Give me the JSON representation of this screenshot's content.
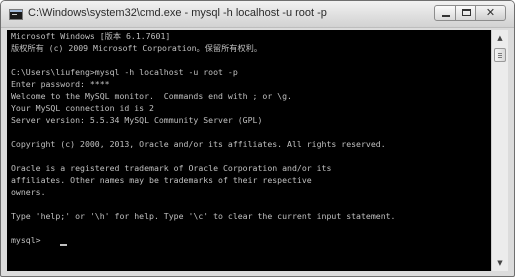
{
  "window": {
    "title": "C:\\Windows\\system32\\cmd.exe - mysql  -h localhost -u root -p",
    "icon": "terminal-icon",
    "controls": {
      "minimize_icon": "minimize-icon",
      "maximize_icon": "maximize-icon",
      "close_icon": "close-icon",
      "close_glyph": "✕"
    }
  },
  "console": {
    "background": "#000000",
    "foreground": "#c0c0c0",
    "lines": [
      "Microsoft Windows [版本 6.1.7601]",
      "版权所有 (c) 2009 Microsoft Corporation。保留所有权利。",
      "",
      "C:\\Users\\liufeng>mysql -h localhost -u root -p",
      "Enter password: ****",
      "Welcome to the MySQL monitor.  Commands end with ; or \\g.",
      "Your MySQL connection id is 2",
      "Server version: 5.5.34 MySQL Community Server (GPL)",
      "",
      "Copyright (c) 2000, 2013, Oracle and/or its affiliates. All rights reserved.",
      "",
      "Oracle is a registered trademark of Oracle Corporation and/or its",
      "affiliates. Other names may be trademarks of their respective",
      "owners.",
      "",
      "Type 'help;' or '\\h' for help. Type '\\c' to clear the current input statement.",
      "",
      "mysql> "
    ]
  },
  "scrollbar": {
    "up_glyph": "▲",
    "down_glyph": "▼"
  }
}
